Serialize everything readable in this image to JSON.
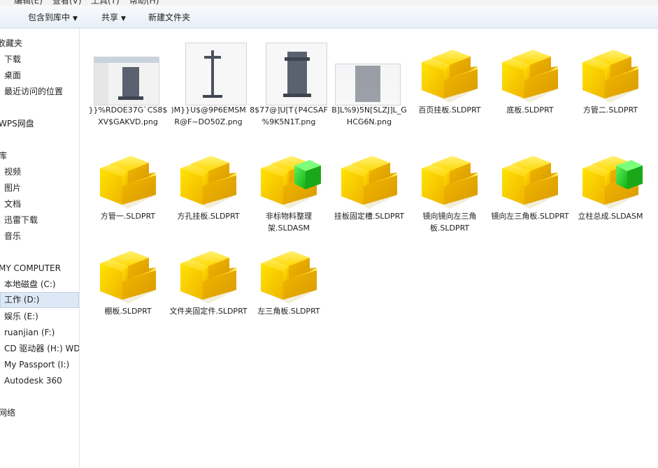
{
  "menubar": {
    "items": [
      "",
      "编辑(E)",
      "查看(V)",
      "工具(T)",
      "帮助(H)"
    ]
  },
  "toolbar": {
    "include_library": "包含到库中",
    "share": "共享",
    "new_folder": "新建文件夹"
  },
  "sidebar": {
    "favorites": "收藏夹",
    "items_fav": [
      "下载",
      "桌面",
      "最近访问的位置"
    ],
    "wps": "WPS网盘",
    "library": "库",
    "items_lib": [
      "视频",
      "图片",
      "文档",
      "迅雷下载",
      "音乐"
    ],
    "computer": "MY COMPUTER",
    "drives": [
      "本地磁盘 (C:)",
      "工作 (D:)",
      "娱乐 (E:)",
      "ruanjian (F:)",
      "CD 驱动器 (H:) WD",
      "My Passport (I:)",
      "Autodesk 360"
    ],
    "network": "网络"
  },
  "files": [
    {
      "kind": "png",
      "name": "}}%RDOE37G`CS8$XV$GAKVD.png"
    },
    {
      "kind": "png",
      "name": ")M}}U$@9P6EMSMR@F~DO50Z.png"
    },
    {
      "kind": "png",
      "name": "8$77@]U[T{P4CSAF%9K5N1T.png"
    },
    {
      "kind": "png",
      "name": "B]L%9)5N[SLZJ]L_GHCG6N.png"
    },
    {
      "kind": "part",
      "name": "百页挂板.SLDPRT"
    },
    {
      "kind": "part",
      "name": "底板.SLDPRT"
    },
    {
      "kind": "part",
      "name": "方管二.SLDPRT"
    },
    {
      "kind": "part",
      "name": "方管一.SLDPRT"
    },
    {
      "kind": "part",
      "name": "方孔挂板.SLDPRT"
    },
    {
      "kind": "asm",
      "name": "非标物料整理架.SLDASM"
    },
    {
      "kind": "part",
      "name": "挂板固定槽.SLDPRT"
    },
    {
      "kind": "part",
      "name": "镜向镜向左三角板.SLDPRT"
    },
    {
      "kind": "part",
      "name": "镜向左三角板.SLDPRT"
    },
    {
      "kind": "asm",
      "name": "立柱总成.SLDASM"
    },
    {
      "kind": "part",
      "name": "棚板.SLDPRT"
    },
    {
      "kind": "part",
      "name": "文件夹固定件.SLDPRT"
    },
    {
      "kind": "part",
      "name": "左三角板.SLDPRT"
    }
  ]
}
